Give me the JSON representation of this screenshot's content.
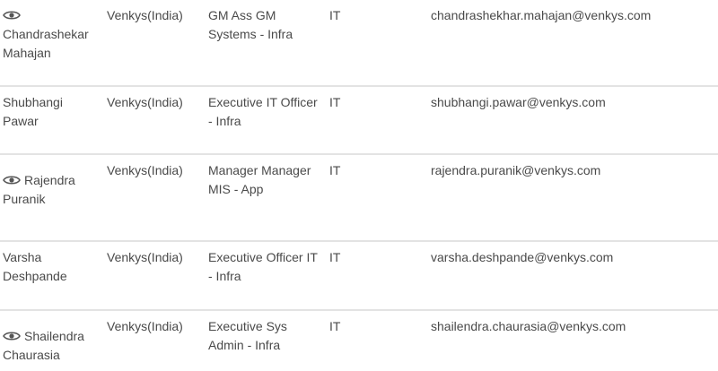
{
  "rows": [
    {
      "has_view_icon": true,
      "name": "Chandrashekar Mahajan",
      "company": "Venkys(India)",
      "designation": "GM Ass GM Systems - Infra",
      "department": "IT",
      "email": "chandrashekhar.mahajan@venkys.com"
    },
    {
      "has_view_icon": false,
      "name": "Shubhangi Pawar",
      "company": "Venkys(India)",
      "designation": "Executive IT Officer - Infra",
      "department": "IT",
      "email": "shubhangi.pawar@venkys.com"
    },
    {
      "has_view_icon": true,
      "name": "Rajendra Puranik",
      "company": "Venkys(India)",
      "designation": "Manager Manager MIS - App",
      "department": "IT",
      "email": "rajendra.puranik@venkys.com"
    },
    {
      "has_view_icon": false,
      "name": "Varsha Deshpande",
      "company": "Venkys(India)",
      "designation": "Executive Officer IT - Infra",
      "department": "IT",
      "email": "varsha.deshpande@venkys.com"
    },
    {
      "has_view_icon": true,
      "name": "Shailendra Chaurasia",
      "company": "Venkys(India)",
      "designation": "Executive Sys Admin - Infra",
      "department": "IT",
      "email": "shailendra.chaurasia@venkys.com"
    }
  ],
  "icons": {
    "view": "eye-icon"
  },
  "colors": {
    "text": "#4a4a4a",
    "divider": "#e3e3e3",
    "icon": "#555555"
  }
}
